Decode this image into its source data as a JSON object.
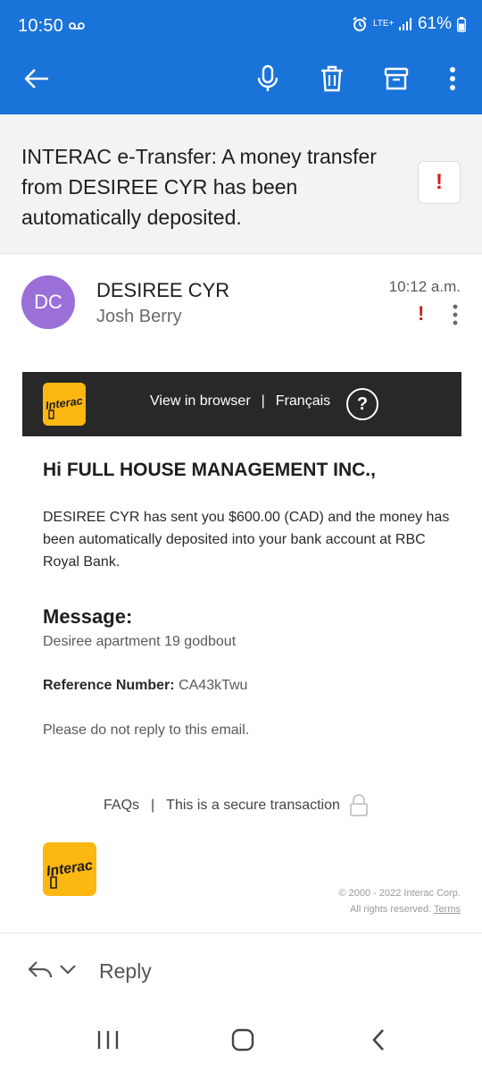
{
  "status_bar": {
    "time": "10:50",
    "network": "LTE+",
    "battery": "61%"
  },
  "toolbar": {
    "icons": [
      "back-arrow-icon",
      "microphone-icon",
      "trash-icon",
      "archive-icon",
      "more-vert-icon"
    ]
  },
  "email": {
    "subject": "INTERAC e-Transfer: A money transfer from DESIREE CYR has been automatically deposited.",
    "flag": "!",
    "avatar_initials": "DC",
    "avatar_color": "#9b6fd8",
    "sender": "DESIREE CYR",
    "recipient": "Josh Berry",
    "time": "10:12 a.m."
  },
  "banner": {
    "logo_text": "Interac",
    "view_in_browser": "View in browser",
    "separator": "|",
    "language": "Français",
    "help": "?"
  },
  "content": {
    "greeting": "Hi FULL HOUSE MANAGEMENT INC.,",
    "body": "DESIREE CYR has sent you $600.00 (CAD) and the money has been automatically deposited into your bank account at RBC Royal Bank.",
    "message_heading": "Message:",
    "message_text": "Desiree apartment 19 godbout",
    "reference_label": "Reference Number:",
    "reference_value": "CA43kTwu",
    "no_reply": "Please do not reply to this email."
  },
  "footer": {
    "faqs": "FAQs",
    "separator": "|",
    "secure": "This is a secure transaction",
    "logo_text": "Interac",
    "copyright_line1": "© 2000 - 2022 Interac Corp.",
    "copyright_line2": "All rights reserved.",
    "terms": "Terms"
  },
  "reply_bar": {
    "label": "Reply"
  },
  "colors": {
    "header_blue": "#1a73d9",
    "interac_yellow": "#fcb713",
    "banner_dark": "#282828",
    "flag_red": "#d01d1d"
  }
}
